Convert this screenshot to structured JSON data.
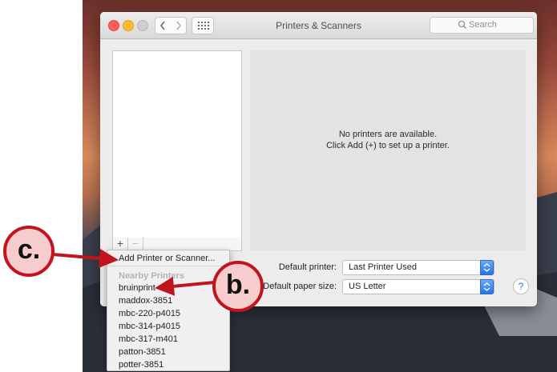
{
  "window": {
    "title": "Printers & Scanners",
    "search_placeholder": "Search"
  },
  "printer_list": {
    "add_label": "+",
    "remove_label": "−"
  },
  "detail": {
    "empty_line1": "No printers are available.",
    "empty_line2": "Click Add (+) to set up a printer."
  },
  "settings": {
    "default_printer_label": "Default printer:",
    "default_printer_value": "Last Printer Used",
    "paper_size_label": "Default paper size:",
    "paper_size_value": "US Letter",
    "help_label": "?"
  },
  "menu": {
    "add_item": "Add Printer or Scanner...",
    "nearby_heading": "Nearby Printers",
    "printers": [
      "bruinprint",
      "maddox-3851",
      "mbc-220-p4015",
      "mbc-314-p4015",
      "mbc-317-m401",
      "patton-3851",
      "potter-3851"
    ]
  },
  "annotations": {
    "c_label": "c.",
    "b_label": "b."
  },
  "colors": {
    "annotation_red": "#c0141e",
    "annotation_fill": "#f6cccc",
    "accent_blue": "#2a73e6"
  }
}
